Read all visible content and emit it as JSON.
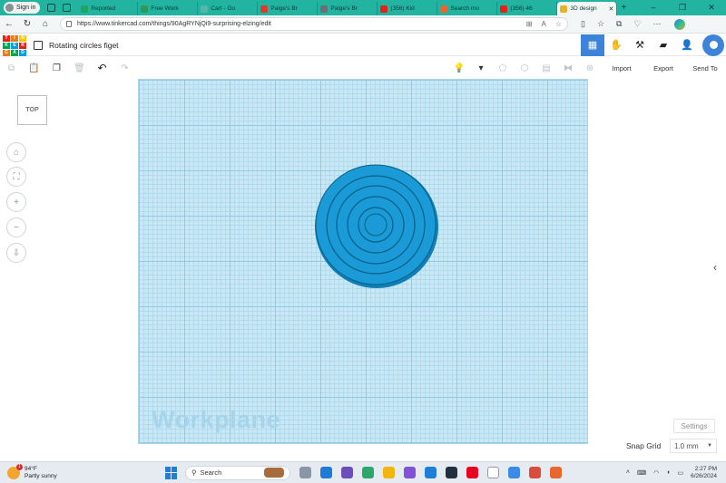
{
  "browser": {
    "signin_label": "Sign in",
    "tabs": [
      {
        "label": "Reported",
        "color": "#21a366"
      },
      {
        "label": "Free Work",
        "color": "#2c9a5d"
      },
      {
        "label": "Cart - Go",
        "color": "#55b6a8"
      },
      {
        "label": "Paige's Br",
        "color": "#d83b30"
      },
      {
        "label": "Paige's Br",
        "color": "#6b6f73"
      },
      {
        "label": "(356) Kid",
        "color": "#e62117"
      },
      {
        "label": "Search mo",
        "color": "#e8672e"
      },
      {
        "label": "(356) 46",
        "color": "#e62117"
      },
      {
        "label": "3D design",
        "color": "#e6b422",
        "active": true
      }
    ],
    "new_tab_icon": "+",
    "window_controls": [
      "–",
      "❐",
      "✕"
    ],
    "url": "https://www.tinkercad.com/things/90AgRYNjQi9-surprising-elzing/edit"
  },
  "app": {
    "logo_letters": [
      "T",
      "I",
      "N",
      "K",
      "E",
      "R",
      "C",
      "A",
      "D"
    ],
    "logo_colors": [
      "#e2231a",
      "#e87b1d",
      "#f7c900",
      "#00a650",
      "#00a0df",
      "#e2231a",
      "#e87b1d",
      "#00a650",
      "#00a0df"
    ],
    "design_title": "Rotating circles figet",
    "toolbar": {
      "import_label": "Import",
      "export_label": "Export",
      "sendto_label": "Send To"
    },
    "view_cube_label": "TOP",
    "workplane_label": "Workplane",
    "settings_label": "Settings",
    "snap_grid_label": "Snap Grid",
    "snap_grid_value": "1.0 mm",
    "shape_color": "#1a9ad6"
  },
  "taskbar": {
    "weather_badge": "1",
    "temperature": "94°F",
    "condition": "Partly sunny",
    "search_placeholder": "Search",
    "time": "2:27 PM",
    "date": "6/26/2024",
    "apps": [
      "#8a96a6",
      "#1e7bd6",
      "#6b4fbb",
      "#2ca86a",
      "#f2b50f",
      "#8251d6",
      "#1f7fd6",
      "#232f3e",
      "#e60023",
      "#ffffff",
      "#3b8ae6",
      "#d94d3a",
      "#e8672e"
    ]
  }
}
